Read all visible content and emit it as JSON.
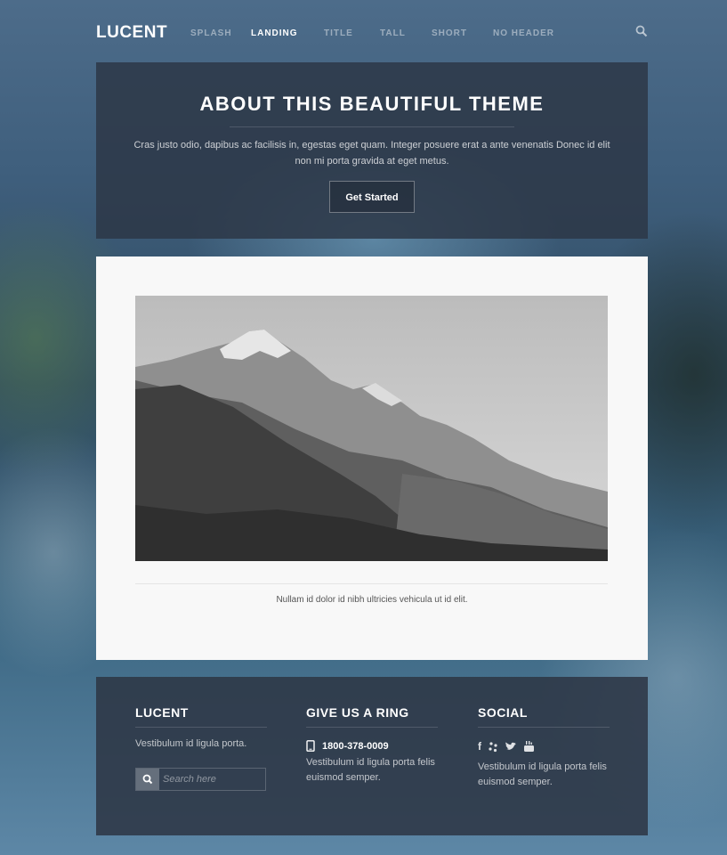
{
  "nav": {
    "brand": "LUCENT",
    "items": [
      "SPLASH",
      "LANDING",
      "TITLE",
      "TALL",
      "SHORT",
      "NO HEADER"
    ]
  },
  "hero": {
    "title": "ABOUT THIS BEAUTIFUL THEME",
    "text": "Cras justo odio, dapibus ac facilisis in, egestas eget quam. Integer posuere erat a ante venenatis Donec id elit non mi porta gravida at eget metus.",
    "cta": "Get Started"
  },
  "content": {
    "caption": "Nullam id dolor id nibh ultricies vehicula ut id elit."
  },
  "footer": {
    "col1": {
      "title": "LUCENT",
      "text": "Vestibulum id ligula porta.",
      "search_placeholder": "Search here"
    },
    "col2": {
      "title": "GIVE US A RING",
      "phone": "1800-378-0009",
      "text": "Vestibulum id ligula porta felis euismod semper."
    },
    "col3": {
      "title": "SOCIAL",
      "icons": [
        "facebook-icon",
        "yelp-icon",
        "twitter-icon",
        "youtube-icon"
      ],
      "text": "Vestibulum id ligula porta felis euismod semper."
    }
  },
  "colors": {
    "panel": "#2d3746",
    "content_bg": "#f8f8f8",
    "text_light": "#ffffff"
  }
}
